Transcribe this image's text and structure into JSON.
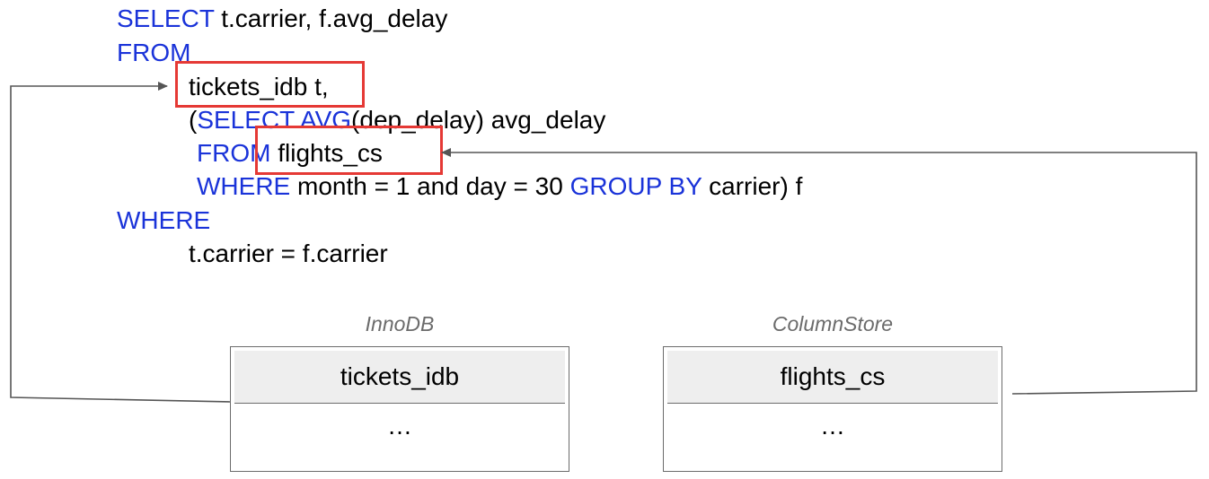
{
  "sql": {
    "l1_kw": "SELECT",
    "l1_text": " t.carrier, f.avg_delay",
    "l2_kw": "FROM",
    "l3_text": "tickets_idb t,",
    "l4_open": "(",
    "l4_kw1": "SELECT",
    "l4_kw2": "AVG",
    "l4_text": "(dep_delay) avg_delay",
    "l5_kw": "FROM",
    "l5_text": " flights_cs",
    "l6_kw1": "WHERE",
    "l6_text1": " month = 1 and day = 30 ",
    "l6_kw2": "GROUP BY",
    "l6_text2": " carrier) f",
    "l7_kw": "WHERE",
    "l8_text": "t.carrier = f.carrier"
  },
  "tables": {
    "innodb": {
      "engine": "InnoDB",
      "name": "tickets_idb",
      "more": "…"
    },
    "columnstore": {
      "engine": "ColumnStore",
      "name": "flights_cs",
      "more": "…"
    }
  },
  "colors": {
    "keyword": "#1a33d9",
    "highlight": "#e53935",
    "connector": "#555555"
  }
}
